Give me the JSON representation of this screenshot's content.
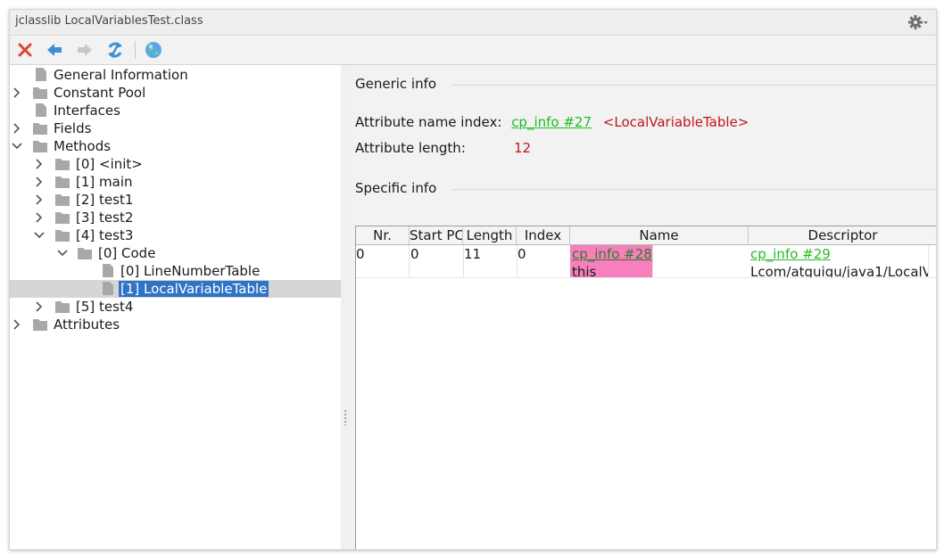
{
  "window": {
    "title": "jclasslib LocalVariablesTest.class"
  },
  "toolbar": {
    "close_icon": "close-icon",
    "back_icon": "arrow-left-icon",
    "forward_icon": "arrow-right-icon",
    "refresh_icon": "refresh-icon",
    "browser_icon": "globe-icon",
    "settings_icon": "gear-icon"
  },
  "tree": {
    "items": [
      {
        "label": "General Information"
      },
      {
        "label": "Constant Pool"
      },
      {
        "label": "Interfaces"
      },
      {
        "label": "Fields"
      },
      {
        "label": "Methods"
      },
      {
        "label": "[0] <init>"
      },
      {
        "label": "[1] main"
      },
      {
        "label": "[2] test1"
      },
      {
        "label": "[3] test2"
      },
      {
        "label": "[4] test3"
      },
      {
        "label": "[0] Code"
      },
      {
        "label": "[0] LineNumberTable"
      },
      {
        "label": "[1] LocalVariableTable"
      },
      {
        "label": "[5] test4"
      },
      {
        "label": "Attributes"
      }
    ]
  },
  "generic": {
    "section_title": "Generic info",
    "name_index_label": "Attribute name index:",
    "name_index_link": "cp_info #27",
    "name_index_value": "<LocalVariableTable>",
    "length_label": "Attribute length:",
    "length_value": "12"
  },
  "specific": {
    "section_title": "Specific info",
    "table": {
      "columns": [
        "Nr.",
        "Start PC",
        "Length",
        "Index",
        "Name",
        "Descriptor"
      ],
      "rows": [
        {
          "nr": "0",
          "start_pc": "0",
          "length": "11",
          "index": "0",
          "name_link": "cp_info #28",
          "name_value": "this",
          "descriptor_link": "cp_info #29",
          "descriptor_value": "Lcom/atguigu/java1/LocalV"
        }
      ]
    }
  },
  "colors": {
    "selection": "#2f73c6",
    "link": "#22bb22",
    "value": "#c0151b",
    "highlight_cell": "#f77fbe"
  }
}
